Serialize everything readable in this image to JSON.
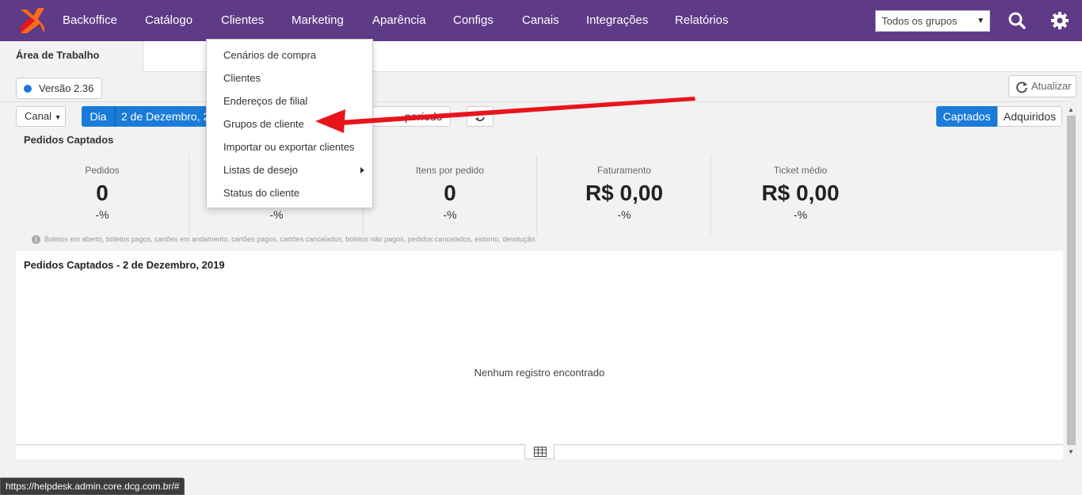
{
  "nav": {
    "items": [
      "Backoffice",
      "Catálogo",
      "Clientes",
      "Marketing",
      "Aparência",
      "Configs",
      "Canais",
      "Integrações",
      "Relatórios"
    ],
    "active": "Clientes",
    "group_select": "Todos os grupos",
    "bg_color": "#5e3a87"
  },
  "workspace": {
    "tab_label": "Área de Trabalho",
    "version_label": "Versão 2.36",
    "refresh_label": "Atualizar"
  },
  "toolbar": {
    "canal_label": "Canal",
    "period_dia": "Dia",
    "period_date": "2 de Dezembro, 20",
    "period_other": "período",
    "seg_captados": "Captados",
    "seg_adquiridos": "Adquiridos",
    "accent_color": "#1a7bd8"
  },
  "section_title": "Pedidos Captados",
  "kpis": [
    {
      "label": "Pedidos",
      "value": "0",
      "delta": "-%"
    },
    {
      "label": "",
      "value": "",
      "delta": "-%"
    },
    {
      "label": "Itens por pedido",
      "value": "0",
      "delta": "-%"
    },
    {
      "label": "Faturamento",
      "value": "R$ 0,00",
      "delta": "-%"
    },
    {
      "label": "Ticket médio",
      "value": "R$ 0,00",
      "delta": "-%"
    }
  ],
  "footnote": "Boletos em aberto, boletos pagos, cartões em andamento, cartões pagos, cartões cancelados, boletos não pagos, pedidos cancelados, estorno, devolução.",
  "chart": {
    "title": "Pedidos Captados - 2 de Dezembro, 2019",
    "empty_message": "Nenhum registro encontrado"
  },
  "clientes_menu": {
    "items": [
      "Cenários de compra",
      "Clientes",
      "Endereços de filial",
      "Grupos de cliente",
      "Importar ou exportar clientes",
      "Listas de desejo",
      "Status do cliente"
    ]
  },
  "status_url": "https://helpdesk.admin.core.dcg.com.br/#",
  "annotation_arrow_color": "#e8141c"
}
